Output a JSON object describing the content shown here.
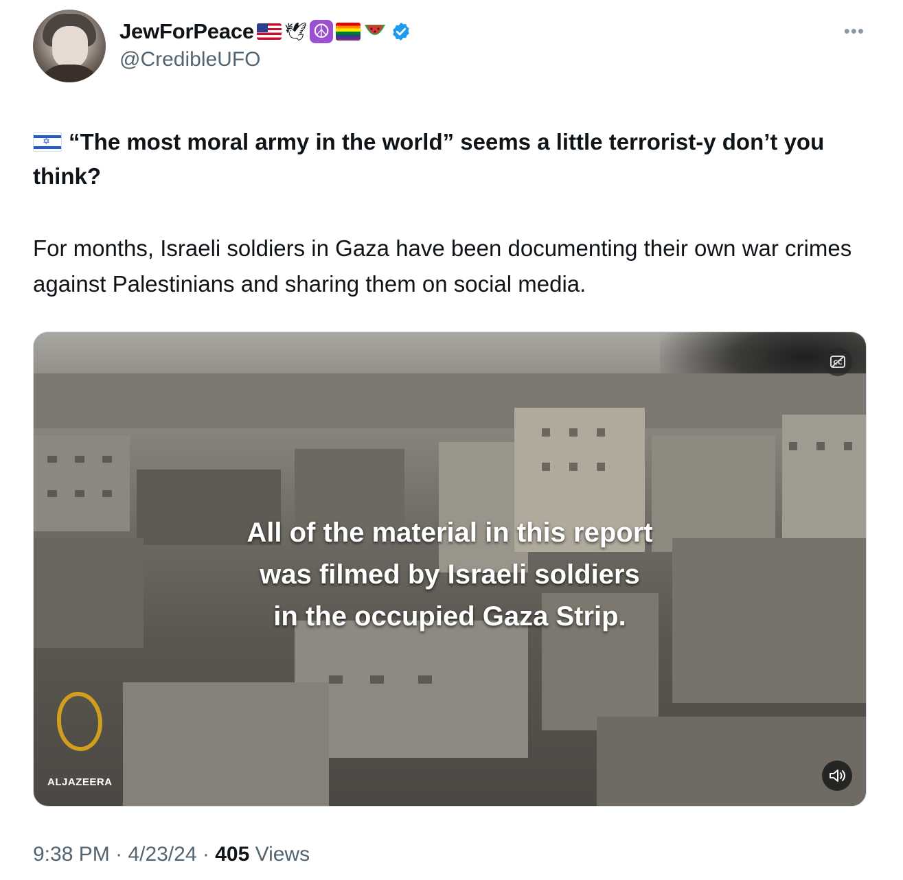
{
  "author": {
    "display_name": "JewForPeace",
    "handle": "@CredibleUFO",
    "name_emojis": [
      "flag-us",
      "dove",
      "peace-symbol",
      "rainbow-flag",
      "watermelon"
    ],
    "verified": true
  },
  "tweet": {
    "prefix_icon": "flag-israel",
    "headline": "“The most moral army in the world” seems a little terrorist-y don’t you think?",
    "body": "For months, Israeli soldiers in Gaza have been documenting their own war crimes against Palestinians and sharing them on social media."
  },
  "media": {
    "caption_lines": [
      "All of the material in this report",
      "was filmed by Israeli soldiers",
      "in the occupied Gaza Strip."
    ],
    "watermark": "ALJAZEERA",
    "captions_button_icon": "captions-off-icon",
    "sound_button_icon": "speaker-icon"
  },
  "meta": {
    "time": "9:38 PM",
    "sep1": "·",
    "date": "4/23/24",
    "sep2": "·",
    "views_count": "405",
    "views_label": "Views"
  },
  "colors": {
    "text": "#0f1419",
    "secondary": "#536471",
    "verified_blue": "#1d9bf0",
    "peace_purple": "#9b4fd1",
    "aljazeera_gold": "#d9a21b"
  }
}
